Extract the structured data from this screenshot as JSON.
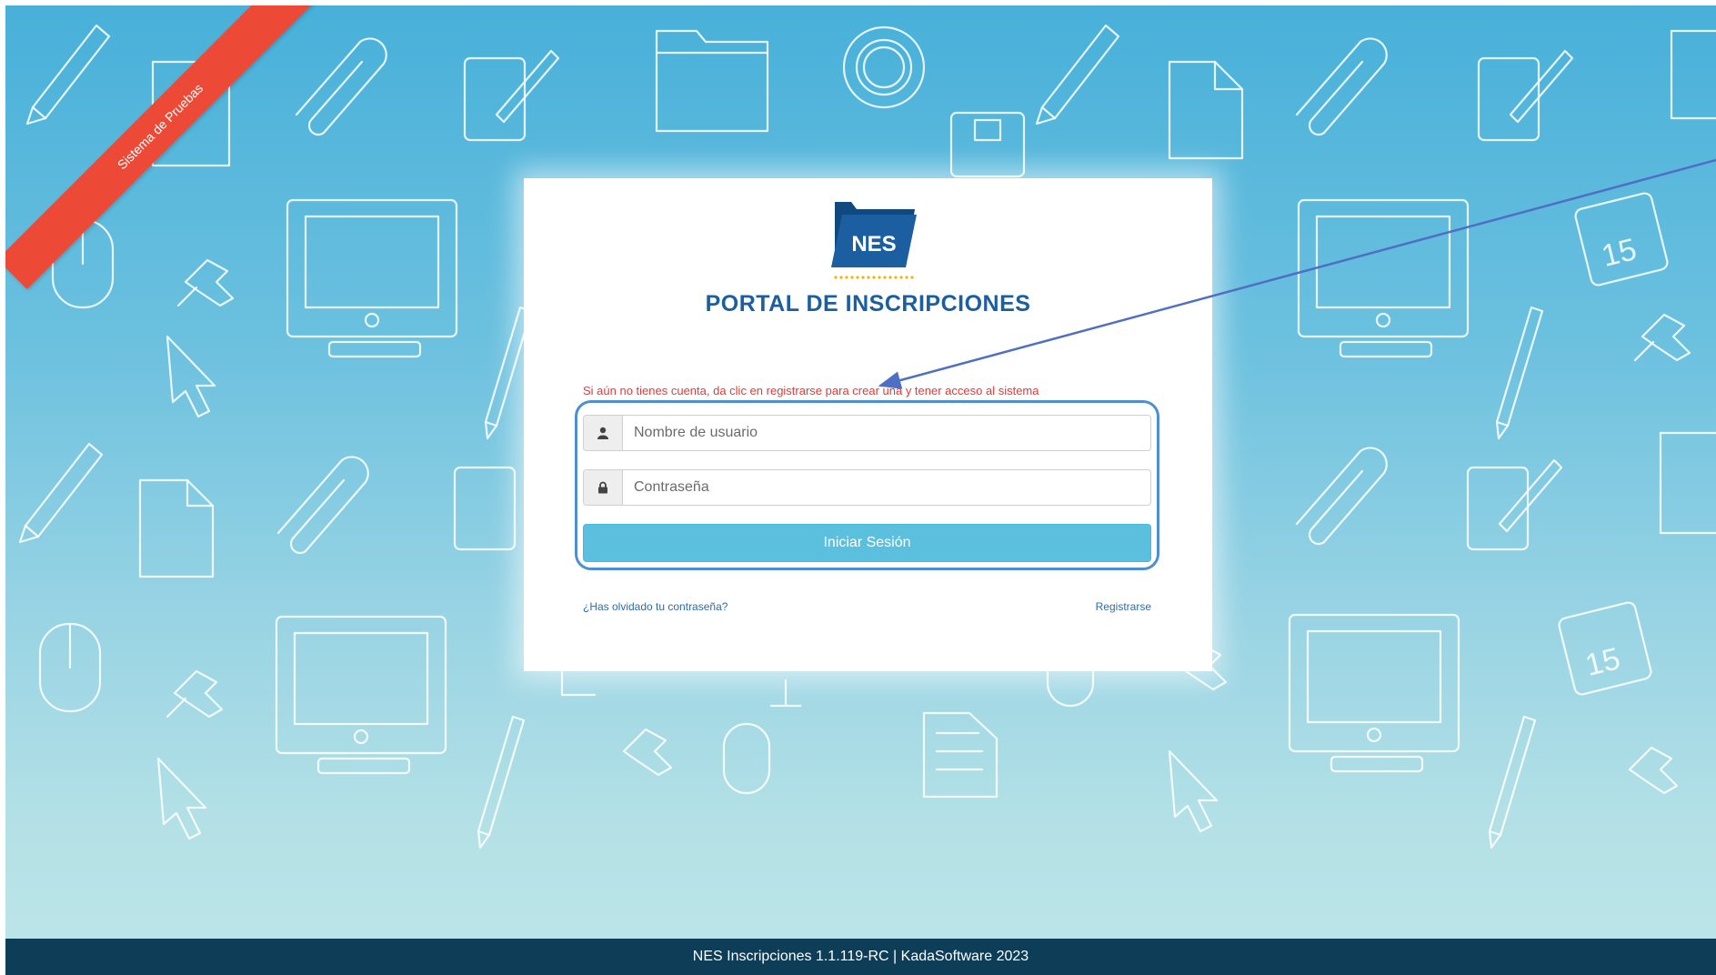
{
  "ribbon": {
    "text": "Sistema de Pruebas",
    "color": "#ec4a37"
  },
  "logo": {
    "text": "NES",
    "brand_color": "#1b5fa0",
    "accent_color": "#f5b400"
  },
  "portal_title": "PORTAL DE INSCRIPCIONES",
  "info_text": "Si aún no tienes cuenta, da clic en registrarse para crear una y tener acceso al sistema",
  "form": {
    "username": {
      "placeholder": "Nombre de usuario",
      "value": "",
      "icon": "user-icon"
    },
    "password": {
      "placeholder": "Contraseña",
      "value": "",
      "icon": "lock-icon"
    },
    "login_label": "Iniciar Sesión"
  },
  "links": {
    "forgot": "¿Has olvidado tu contraseña?",
    "register": "Registrarse"
  },
  "footer": "NES Inscripciones 1.1.119-RC | KadaSoftware 2023",
  "colors": {
    "button": "#5bc0de",
    "info_text": "#e53935",
    "footer_bg": "#0d3d57",
    "annotation": "#4f6fc4"
  },
  "calendar_day": "15"
}
